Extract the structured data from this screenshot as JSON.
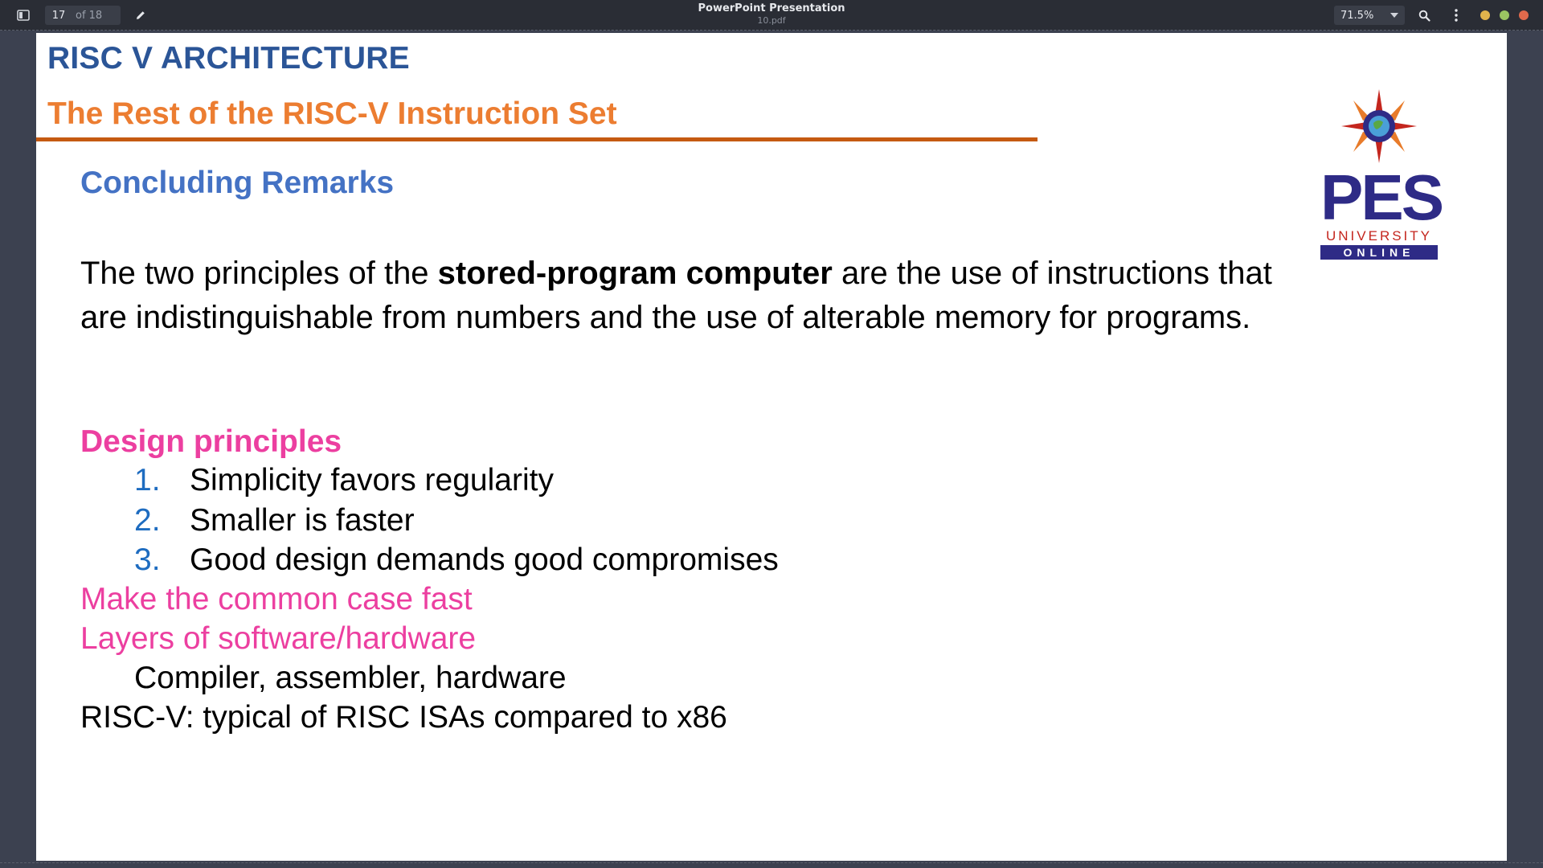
{
  "toolbar": {
    "current_page": "17",
    "page_total": "of 18",
    "title": "PowerPoint Presentation",
    "filename": "10.pdf",
    "zoom": "71.5%"
  },
  "slide": {
    "title": "RISC V ARCHITECTURE",
    "subtitle": "The Rest of the RISC-V Instruction Set",
    "heading": "Concluding Remarks",
    "para_pre": "The two principles of the ",
    "para_bold": "stored-program computer",
    "para_post": " are the use of instructions that are indistinguishable from numbers and the use of alterable memory for programs.",
    "design_heading": "Design principles",
    "principles": [
      {
        "num": "1.",
        "text": "Simplicity favors regularity"
      },
      {
        "num": "2.",
        "text": "Smaller is faster"
      },
      {
        "num": "3.",
        "text": "Good design demands good compromises"
      }
    ],
    "line_common_case": "Make the common case fast",
    "line_layers": "Layers of software/hardware",
    "line_layers_detail": "Compiler, assembler, hardware",
    "line_riscv": "RISC-V: typical of RISC ISAs compared to x86"
  },
  "logo": {
    "name": "PES",
    "university": "UNIVERSITY",
    "online": "ONLINE"
  },
  "colors": {
    "title": "#2b5597",
    "subtitle": "#ec7d31",
    "rule": "#c55a11",
    "heading": "#4472c4",
    "pink": "#ec3fa0",
    "list_number": "#1e6cc0",
    "logo_navy": "#2e2b86",
    "logo_red": "#c4261e"
  },
  "icons": [
    "sidebar-toggle-icon",
    "pencil-icon",
    "chevron-down-icon",
    "search-icon",
    "kebab-menu-icon"
  ]
}
